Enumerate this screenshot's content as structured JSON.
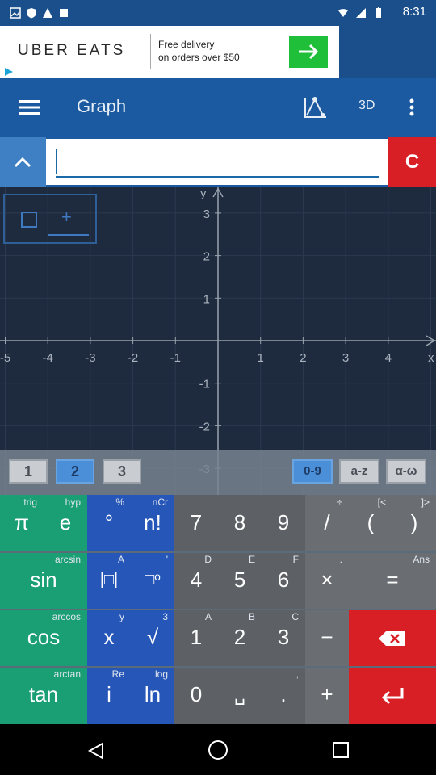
{
  "status": {
    "time": "8:31"
  },
  "ad": {
    "brand": "UBER EATS",
    "line1": "Free delivery",
    "line2": "on orders over $50"
  },
  "toolbar": {
    "title": "Graph",
    "mode_3d": "3D"
  },
  "input": {
    "value": "",
    "clear_label": "C"
  },
  "graph": {
    "x_label": "x",
    "y_label": "y",
    "x_ticks": [
      "-5",
      "-4",
      "-3",
      "-2",
      "-1",
      "1",
      "2",
      "3",
      "4"
    ],
    "y_ticks": [
      "3",
      "2",
      "1",
      "-1",
      "-2",
      "-3"
    ]
  },
  "tabs": {
    "left": [
      "1",
      "2",
      "3"
    ],
    "right": [
      "0-9",
      "a-z",
      "α-ω"
    ]
  },
  "keys": {
    "row1": [
      {
        "main": "π",
        "sup": "trig"
      },
      {
        "main": "e",
        "sup": "hyp"
      },
      {
        "main": "°",
        "sup": "%"
      },
      {
        "main": "n!",
        "sup": "nCr"
      },
      {
        "main": "7",
        "sup": ""
      },
      {
        "main": "8",
        "sup": ""
      },
      {
        "main": "9",
        "sup": ""
      },
      {
        "main": "/",
        "sup": "÷"
      },
      {
        "main": "(",
        "sup": "[<"
      },
      {
        "main": ")",
        "sup": "]>"
      }
    ],
    "row2": [
      {
        "main": "sin",
        "sup": "arcsin"
      },
      {
        "main": "|□|",
        "sup": "A"
      },
      {
        "main": "□ᵒ",
        "sup": "'"
      },
      {
        "main": "4",
        "sup": "D"
      },
      {
        "main": "5",
        "sup": "E"
      },
      {
        "main": "6",
        "sup": "F"
      },
      {
        "main": "×",
        "sup": "."
      },
      {
        "main": "=",
        "sup": "Ans"
      }
    ],
    "row3": [
      {
        "main": "cos",
        "sup": "arccos"
      },
      {
        "main": "x",
        "sup": "y"
      },
      {
        "main": "√",
        "sup": "3"
      },
      {
        "main": "1",
        "sup": "A"
      },
      {
        "main": "2",
        "sup": "B"
      },
      {
        "main": "3",
        "sup": "C"
      },
      {
        "main": "−",
        "sup": ""
      }
    ],
    "row4": [
      {
        "main": "tan",
        "sup": "arctan"
      },
      {
        "main": "i",
        "sup": "Re"
      },
      {
        "main": "ln",
        "sup": "log"
      },
      {
        "main": "0",
        "sup": ""
      },
      {
        "main": "␣",
        "sup": ""
      },
      {
        "main": ".",
        "sup": ","
      },
      {
        "main": "+",
        "sup": ""
      }
    ]
  },
  "colors": {
    "accent_blue": "#1b5aa0",
    "clear_red": "#d91f26",
    "key_green": "#1a9e73",
    "key_blue": "#2656b8",
    "key_gray": "#5d6166"
  }
}
